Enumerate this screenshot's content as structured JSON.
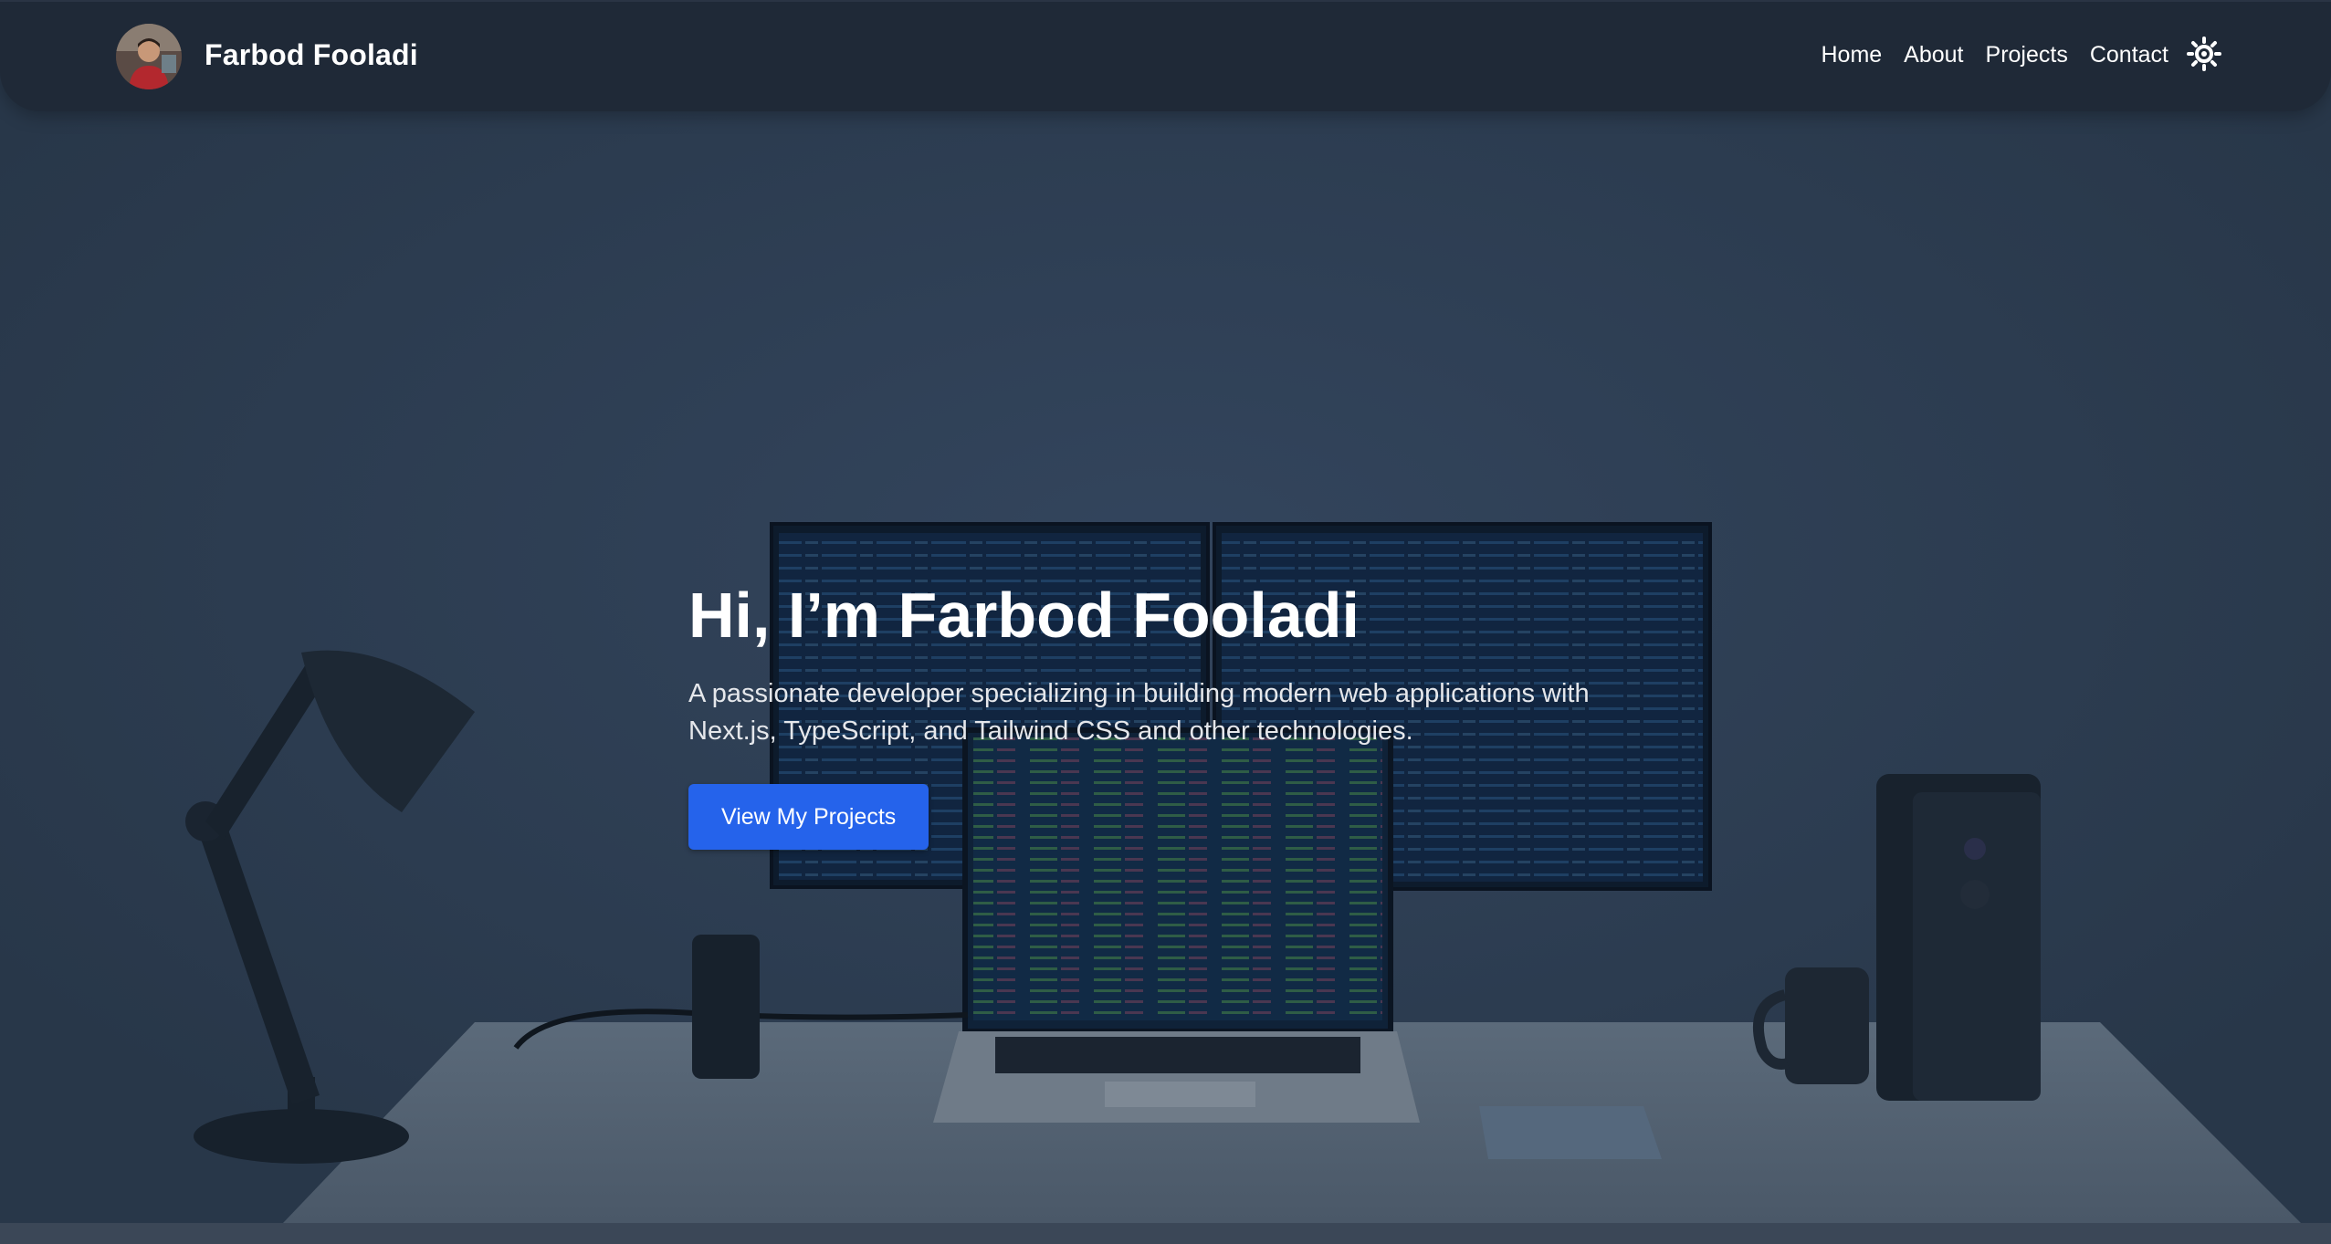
{
  "brand": {
    "name": "Farbod Fooladi",
    "avatar_alt": "Farbod Fooladi avatar"
  },
  "nav": {
    "links": [
      "Home",
      "About",
      "Projects",
      "Contact"
    ],
    "theme_icon": "sun-icon"
  },
  "hero": {
    "title": "Hi, I’m Farbod Fooladi",
    "subtitle": "A passionate developer specializing in building modern web applications with Next.js, TypeScript, and Tailwind CSS and other technologies.",
    "cta_label": "View My Projects",
    "background": "desk-setup-with-monitors-and-laptop"
  },
  "colors": {
    "navbar": "#1f2937",
    "accent": "#2563eb",
    "overlay": "#2b3b50"
  }
}
